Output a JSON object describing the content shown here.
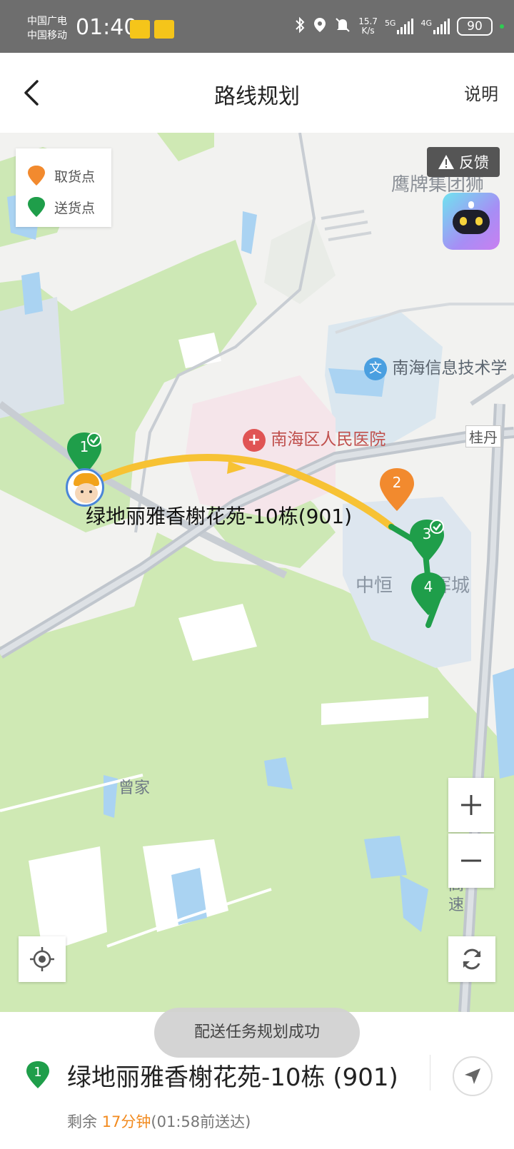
{
  "status_bar": {
    "carrier_1": "中国广电",
    "carrier_2": "中国移动",
    "time": "01:40",
    "net_speed": "15.7",
    "net_unit": "K/s",
    "sig_5g": "5G",
    "sig_4g": "4G",
    "battery": "90"
  },
  "header": {
    "title": "路线规划",
    "right_action": "说明"
  },
  "map": {
    "legend": {
      "pickup_label": "取货点",
      "delivery_label": "送货点",
      "pickup_color": "#f28a2e",
      "delivery_color": "#1f9e4a"
    },
    "feedback_label": "反馈",
    "place_labels": {
      "eagle": "鹰牌集团狮",
      "school": "南海信息技术学",
      "hospital": "南海区人民医院",
      "guidan": "桂丹",
      "zhongheng_left": "中恒",
      "zhongheng_right": "晖城",
      "zengjia": "曾家",
      "highway_1": "高",
      "highway_2": "速"
    },
    "markers": {
      "m1": "1",
      "m2": "2",
      "m3": "3",
      "m4": "4"
    },
    "route_label": "绿地丽雅香榭花苑-10栋(901)",
    "route_color": "#f7c234"
  },
  "toast": "配送任务规划成功",
  "bottom": {
    "pin_number": "1",
    "address": "绿地丽雅香榭花苑-10栋 (901)",
    "remain_prefix": "剩余 ",
    "remain_time": "17分钟",
    "remain_suffix": "(01:58前送达)"
  }
}
